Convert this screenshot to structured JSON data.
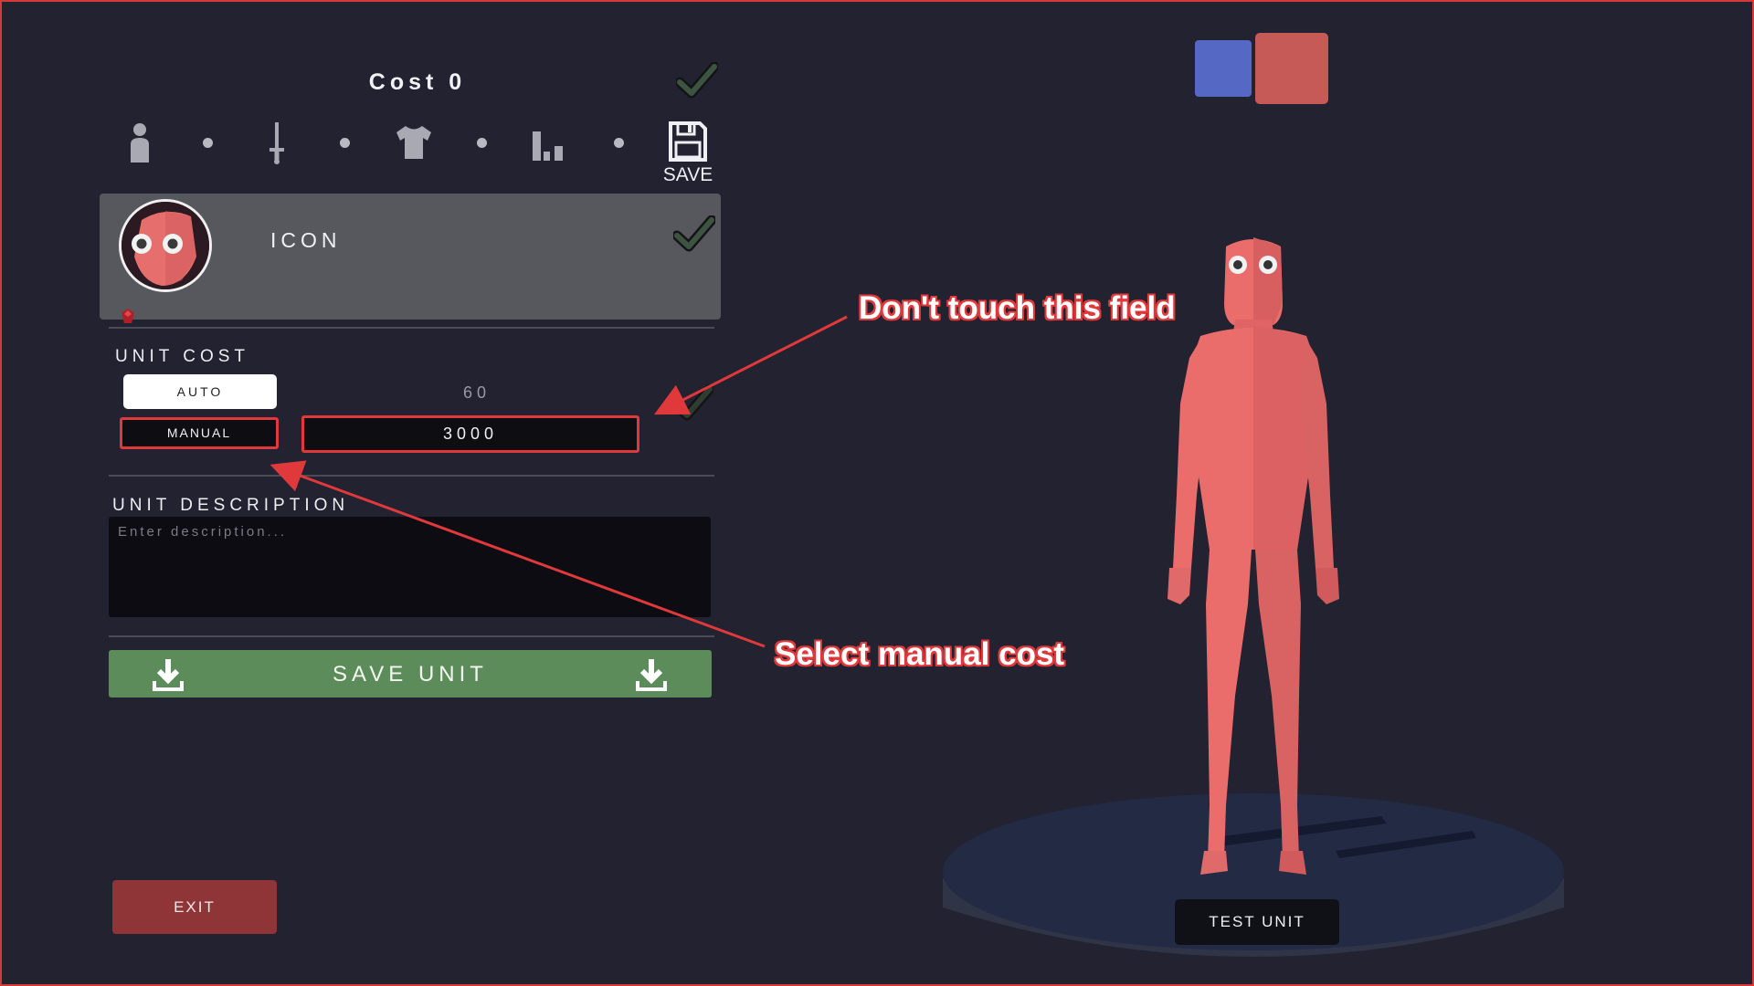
{
  "header": {
    "cost_label": "Cost 0",
    "save_label": "SAVE",
    "steps": [
      "person-icon",
      "sword-icon",
      "shirt-icon",
      "bar-chart-icon"
    ]
  },
  "icon_section": {
    "label": "ICON"
  },
  "unit_cost": {
    "title": "UNIT COST",
    "auto_label": "AUTO",
    "auto_value": "60",
    "manual_label": "MANUAL",
    "manual_value": "3000"
  },
  "unit_description": {
    "title": "UNIT DESCRIPTION",
    "placeholder": "Enter description..."
  },
  "save_unit": {
    "label": "SAVE UNIT"
  },
  "exit": {
    "label": "EXIT"
  },
  "team_colors": {
    "blue": "#5468c4",
    "red": "#c55a57"
  },
  "viewer": {
    "test_unit_label": "TEST UNIT",
    "body_color": "#ea6d6c"
  },
  "annotations": {
    "dont_touch": "Don't touch this field",
    "select_manual": "Select manual cost",
    "color": "#e0393c"
  }
}
